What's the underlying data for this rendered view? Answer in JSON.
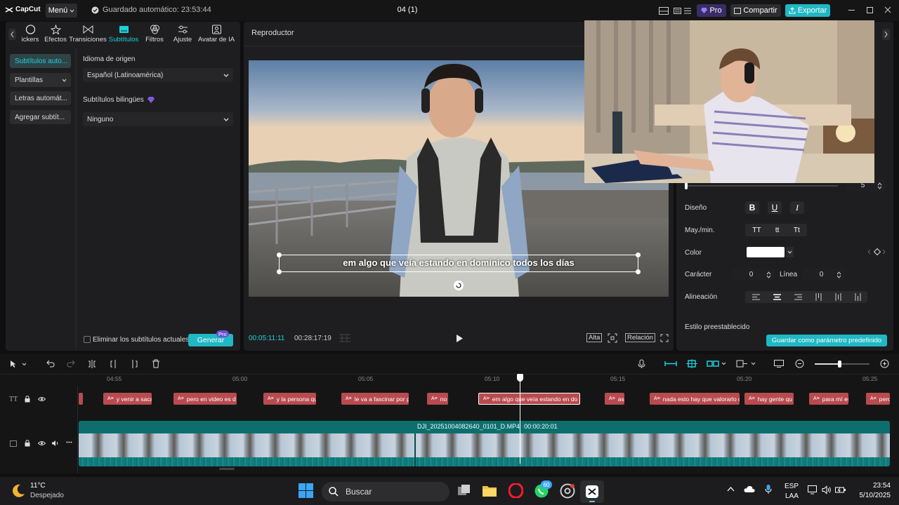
{
  "app": {
    "logo": "CapCut",
    "menu_label": "Menú",
    "autosave": "Guardado automático: 23:53:44",
    "project_title": "04 (1)",
    "pro_label": "Pro",
    "share_label": "Compartir",
    "export_label": "Exportar"
  },
  "left_panel": {
    "tabs": [
      {
        "label": "ickers"
      },
      {
        "label": "Efectos"
      },
      {
        "label": "Transiciones"
      },
      {
        "label": "Subtítulos"
      },
      {
        "label": "Filtros"
      },
      {
        "label": "Ajuste"
      },
      {
        "label": "Avatar de IA"
      }
    ],
    "side_buttons": [
      {
        "label": "Subtítulos auto..."
      },
      {
        "label": "Plantillas"
      },
      {
        "label": "Letras automát..."
      },
      {
        "label": "Agregar subtít..."
      }
    ],
    "source_language_label": "Idioma de origen",
    "source_language_value": "Español (Latinoamérica)",
    "bilingual_label": "Subtítulos bilingües",
    "bilingual_value": "Ninguno",
    "remove_current_label": "Eliminar los subtítulos actuales",
    "generate_label": "Generar",
    "generate_badge": "Pro"
  },
  "player": {
    "title": "Reproductor",
    "caption_text": "em algo que veía estando en domínico todos los días",
    "current_time": "00:05:11:11",
    "total_time": "00:28:17:19",
    "quality_label": "Alta",
    "ratio_label": "Relación"
  },
  "right_panel": {
    "size_value": "5",
    "design_label": "Diseño",
    "bold": "B",
    "underline": "U",
    "italic": "I",
    "case_label": "May./min.",
    "case_options": [
      "TT",
      "tt",
      "Tt"
    ],
    "color_label": "Color",
    "color_value": "#ffffff",
    "char_label": "Carácter",
    "char_value": "0",
    "line_label": "Línea",
    "line_value": "0",
    "align_label": "Alineación",
    "preset_style_label": "Estilo preestablecido",
    "save_preset_label": "Guardar como parámetro predefinido"
  },
  "timeline": {
    "ruler": [
      "04:55",
      "05:00",
      "05:05",
      "05:10",
      "05:15",
      "05:20",
      "05:25"
    ],
    "subtitle_clips": [
      "",
      "y venir a saca",
      "pero en video es d",
      "y la persona qu",
      "le va a fascinar por p",
      "no",
      "em algo que veía estando en do",
      "asi",
      "nada esto hay que valorarlo c",
      "hay gente qu",
      "para mí es",
      "pero"
    ],
    "video_clip_name": "DJI_20251004082640_0101_D.MP4",
    "video_clip_duration": "00:00:20:01"
  },
  "taskbar": {
    "temperature": "11°C",
    "weather": "Despejado",
    "search_label": "Buscar",
    "whatsapp_badge": "60",
    "lang_top": "ESP",
    "lang_bottom": "LAA",
    "time": "23:54",
    "date": "5/10/2025"
  },
  "colors": {
    "accent": "#1dd1dd",
    "subtitle_clip": "#b84b4f",
    "video_track": "#0e6e6e",
    "pro_badge": "#6b4fd8"
  }
}
